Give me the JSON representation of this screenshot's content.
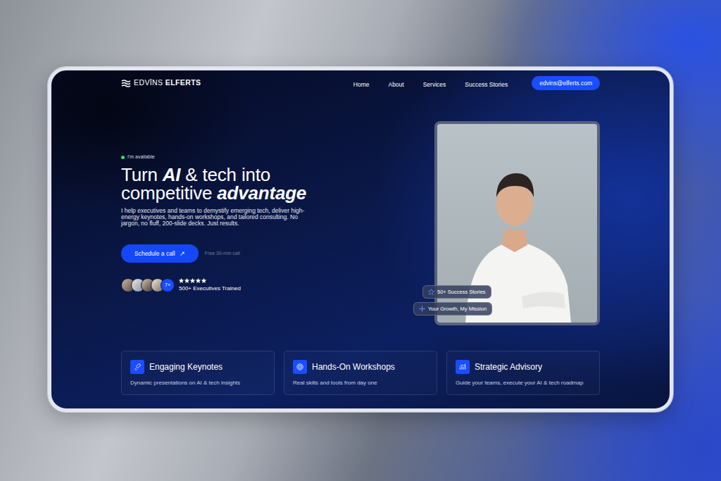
{
  "logo": {
    "first": "EDVĪNS",
    "last": "ELFERTS"
  },
  "nav": {
    "items": [
      {
        "label": "Home"
      },
      {
        "label": "About"
      },
      {
        "label": "Services"
      },
      {
        "label": "Success Stories"
      }
    ],
    "contact": "edvins@elferts.com"
  },
  "hero": {
    "availability": {
      "label": "I'm available",
      "available": true
    },
    "heading": {
      "lines": [
        [
          {
            "text": "Turn ",
            "emphasis": false
          },
          {
            "text": "AI",
            "emphasis": true
          },
          {
            "text": " & tech into",
            "emphasis": false
          }
        ],
        [
          {
            "text": "competitive ",
            "emphasis": false
          },
          {
            "text": "advantage",
            "emphasis": true
          }
        ]
      ]
    },
    "description": "I help executives and teams to demystify emerging tech, deliver high-energy keynotes, hands-on workshops, and tailored consulting. No jargon, no fluff, 200-slide decks. Just results.",
    "cta": {
      "label": "Schedule a call",
      "icon": "↗"
    },
    "cta_note": "Free 30-min call",
    "social_proof": {
      "count_badge": "7+",
      "stars": 5,
      "label": "500+ Executives Trained"
    }
  },
  "portrait": {
    "badges": [
      {
        "label": "50+ Success Stories"
      },
      {
        "label": "Your Growth, My Mission"
      }
    ]
  },
  "services": [
    {
      "title": "Engaging Keynotes",
      "description": "Dynamic presentations on AI & tech insights"
    },
    {
      "title": "Hands-On Workshops",
      "description": "Real skills and tools from day one"
    },
    {
      "title": "Strategic Advisory",
      "description": "Guide your teams, execute your AI & tech roadmap"
    }
  ]
}
